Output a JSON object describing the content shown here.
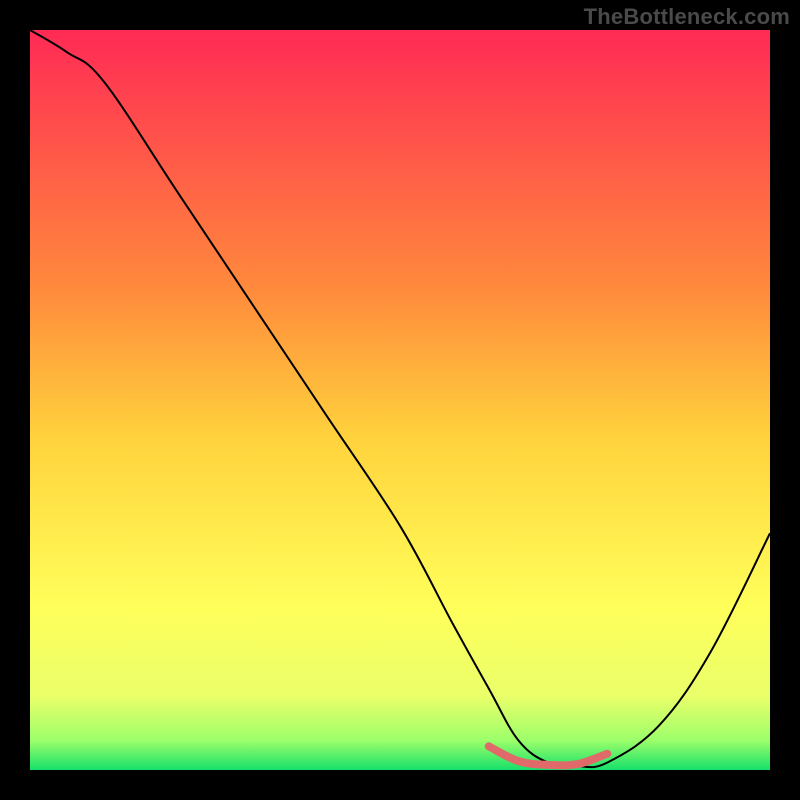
{
  "watermark": "TheBottleneck.com",
  "chart_data": {
    "type": "line",
    "title": "",
    "xlabel": "",
    "ylabel": "",
    "xlim": [
      0,
      100
    ],
    "ylim": [
      0,
      100
    ],
    "gradient_stops": [
      {
        "offset": 0,
        "color": "#ff2a55"
      },
      {
        "offset": 35,
        "color": "#ff8a3c"
      },
      {
        "offset": 55,
        "color": "#ffd23c"
      },
      {
        "offset": 78,
        "color": "#ffff5a"
      },
      {
        "offset": 90,
        "color": "#eaff6a"
      },
      {
        "offset": 96,
        "color": "#9cff6a"
      },
      {
        "offset": 100,
        "color": "#16e06a"
      }
    ],
    "series": [
      {
        "name": "bottleneck-curve",
        "x": [
          0,
          5,
          10,
          20,
          30,
          40,
          50,
          57,
          62,
          66,
          70,
          74,
          78,
          85,
          92,
          100
        ],
        "values": [
          100,
          97,
          93,
          78,
          63,
          48,
          33,
          20,
          11,
          4,
          1,
          0.5,
          1,
          6,
          16,
          32
        ]
      }
    ],
    "highlight_segment": {
      "name": "optimal-zone",
      "color": "#e06a6a",
      "x": [
        62,
        66,
        70,
        74,
        78
      ],
      "values": [
        3.2,
        1.2,
        0.7,
        0.8,
        2.2
      ]
    }
  }
}
